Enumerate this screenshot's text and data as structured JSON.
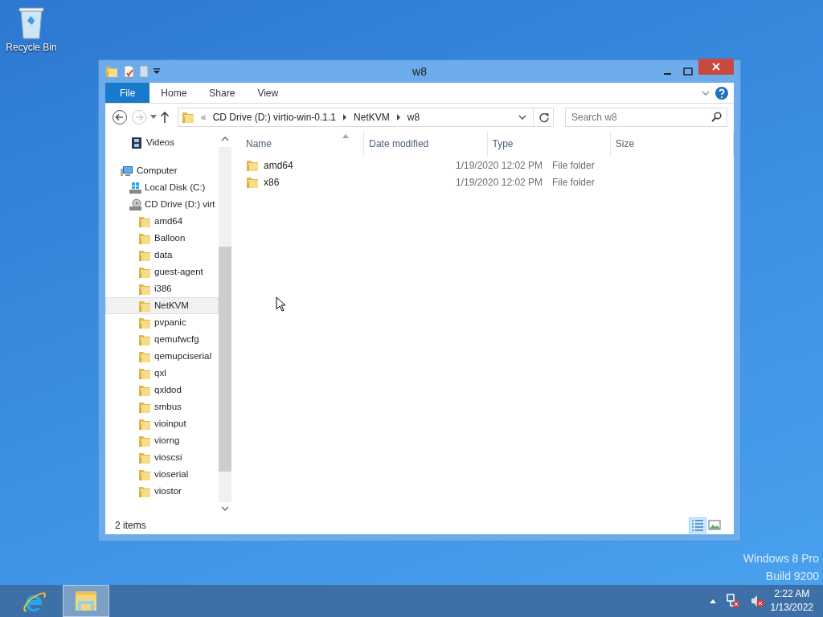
{
  "desktop_icons": [
    {
      "label": "Recycle Bin"
    }
  ],
  "window": {
    "title": "w8",
    "ribbon_tabs": [
      {
        "label": "File",
        "kind": "file"
      },
      {
        "label": "Home",
        "kind": "tab"
      },
      {
        "label": "Share",
        "kind": "tab"
      },
      {
        "label": "View",
        "kind": "tab"
      }
    ],
    "address": {
      "overflow": "«",
      "segments": [
        "CD Drive (D:) virtio-win-0.1.1",
        "NetKVM",
        "w8"
      ]
    },
    "search": {
      "placeholder": "Search w8"
    },
    "nav": [
      {
        "label": "Videos",
        "kind": "video",
        "selected": false
      },
      {
        "label": "Computer",
        "kind": "computer",
        "selected": false,
        "children": [
          {
            "label": "Local Disk (C:)",
            "kind": "disk",
            "selected": false
          },
          {
            "label": "CD Drive (D:) virt",
            "kind": "cd",
            "selected": false,
            "children": [
              {
                "label": "amd64",
                "kind": "folder",
                "selected": false
              },
              {
                "label": "Balloon",
                "kind": "folder",
                "selected": false
              },
              {
                "label": "data",
                "kind": "folder",
                "selected": false
              },
              {
                "label": "guest-agent",
                "kind": "folder",
                "selected": false
              },
              {
                "label": "i386",
                "kind": "folder",
                "selected": false
              },
              {
                "label": "NetKVM",
                "kind": "folder",
                "selected": true
              },
              {
                "label": "pvpanic",
                "kind": "folder",
                "selected": false
              },
              {
                "label": "qemufwcfg",
                "kind": "folder",
                "selected": false
              },
              {
                "label": "qemupciserial",
                "kind": "folder",
                "selected": false
              },
              {
                "label": "qxl",
                "kind": "folder",
                "selected": false
              },
              {
                "label": "qxldod",
                "kind": "folder",
                "selected": false
              },
              {
                "label": "smbus",
                "kind": "folder",
                "selected": false
              },
              {
                "label": "vioinput",
                "kind": "folder",
                "selected": false
              },
              {
                "label": "viorng",
                "kind": "folder",
                "selected": false
              },
              {
                "label": "vioscsi",
                "kind": "folder",
                "selected": false
              },
              {
                "label": "vioserial",
                "kind": "folder",
                "selected": false
              },
              {
                "label": "viostor",
                "kind": "folder",
                "selected": false
              }
            ]
          }
        ]
      }
    ],
    "columns": [
      {
        "label": "Name",
        "sorted": true
      },
      {
        "label": "Date modified",
        "sorted": false
      },
      {
        "label": "Type",
        "sorted": false
      },
      {
        "label": "Size",
        "sorted": false
      }
    ],
    "rows": [
      {
        "name": "amd64",
        "date": "1/19/2020 12:02 PM",
        "type": "File folder"
      },
      {
        "name": "x86",
        "date": "1/19/2020 12:02 PM",
        "type": "File folder"
      }
    ],
    "status_bar": "2 items",
    "views": [
      {
        "kind": "details",
        "selected": true
      },
      {
        "kind": "large",
        "selected": false
      }
    ]
  },
  "watermark": [
    "Windows 8 Pro",
    "Build 9200"
  ],
  "taskbar": {
    "apps": [
      {
        "kind": "ie",
        "active": false
      },
      {
        "kind": "explorer",
        "active": true
      }
    ],
    "time": "2:22 AM",
    "date": "1/13/2022"
  }
}
